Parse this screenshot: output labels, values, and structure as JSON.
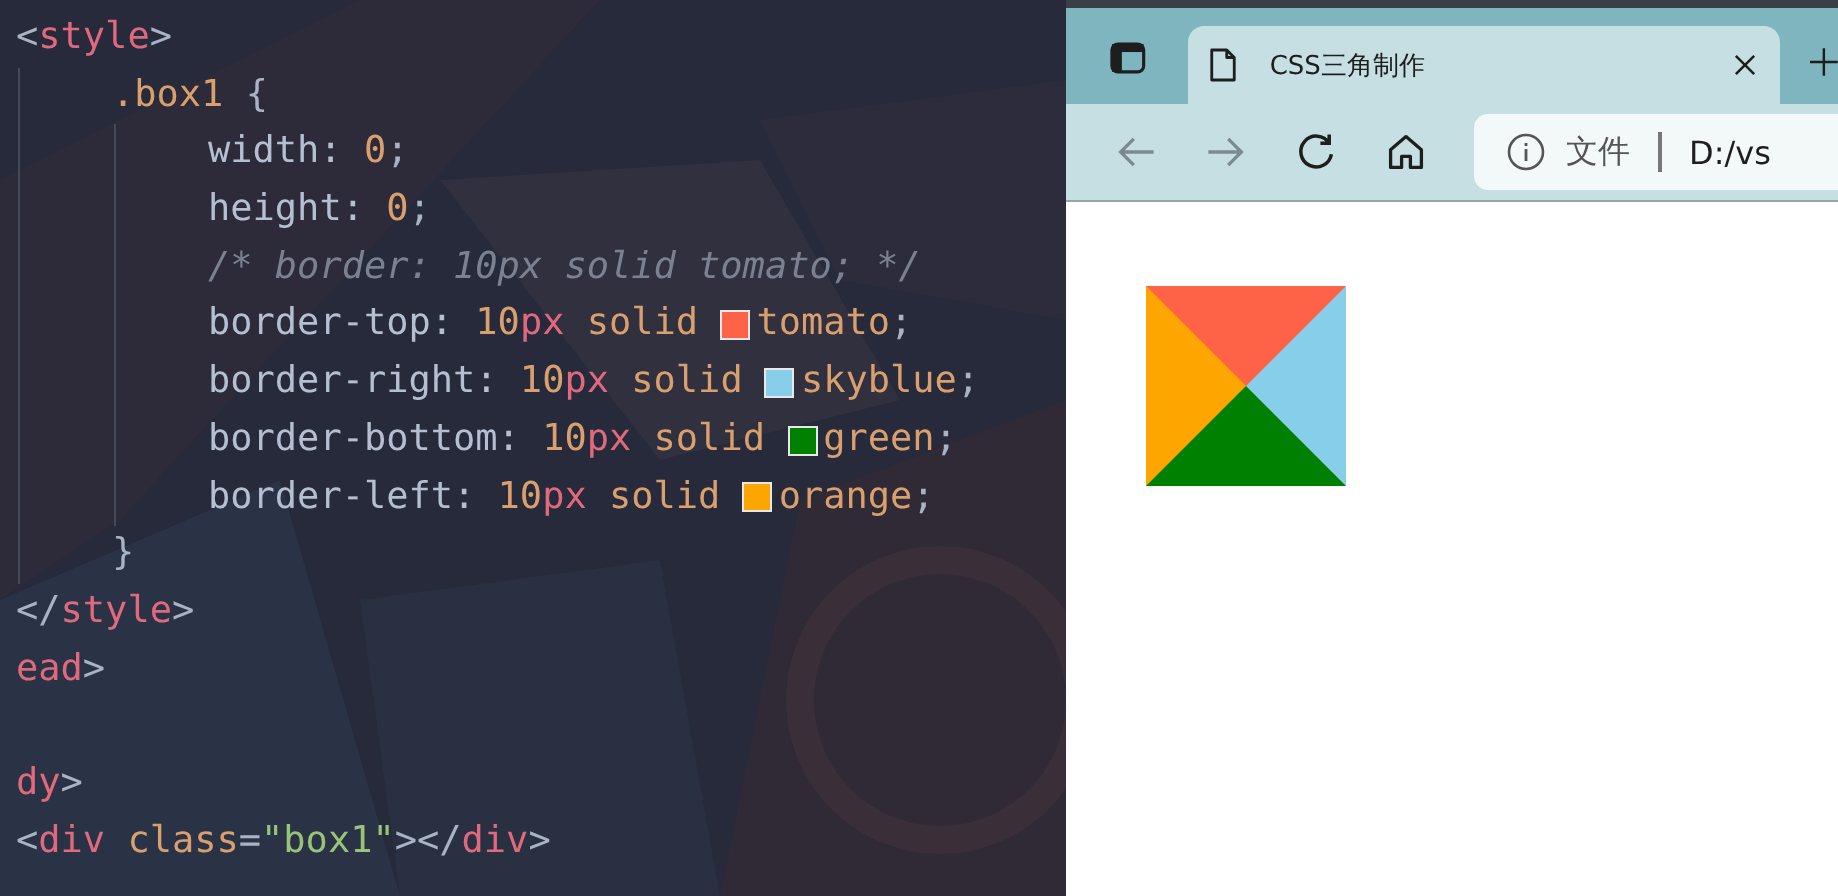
{
  "editor": {
    "groups": [
      {
        "lines": [
          {
            "tokens": [
              {
                "kind": "punct",
                "text": "<"
              },
              {
                "kind": "tag",
                "text": "style"
              },
              {
                "kind": "punct",
                "text": ">"
              }
            ],
            "children": [
              {
                "tokens": [
                  {
                    "kind": "selector",
                    "text": ".box1"
                  },
                  {
                    "kind": "punct",
                    "text": " {"
                  }
                ],
                "children": [
                  {
                    "tokens": [
                      {
                        "kind": "prop",
                        "text": "width:"
                      },
                      {
                        "kind": "num",
                        "text": " 0"
                      },
                      {
                        "kind": "punct",
                        "text": ";"
                      }
                    ]
                  },
                  {
                    "tokens": [
                      {
                        "kind": "prop",
                        "text": "height:"
                      },
                      {
                        "kind": "num",
                        "text": " 0"
                      },
                      {
                        "kind": "punct",
                        "text": ";"
                      }
                    ]
                  },
                  {
                    "tokens": [
                      {
                        "kind": "comment",
                        "text": "/* border: 10px solid tomato; */"
                      }
                    ]
                  },
                  {
                    "tokens": [
                      {
                        "kind": "prop",
                        "text": "border-top:"
                      },
                      {
                        "kind": "num",
                        "text": " 10"
                      },
                      {
                        "kind": "unit",
                        "text": "px"
                      },
                      {
                        "kind": "value",
                        "text": " solid "
                      },
                      {
                        "kind": "swatch",
                        "color": "#ff6347"
                      },
                      {
                        "kind": "value",
                        "text": "tomato"
                      },
                      {
                        "kind": "punct",
                        "text": ";"
                      }
                    ]
                  },
                  {
                    "tokens": [
                      {
                        "kind": "prop",
                        "text": "border-right:"
                      },
                      {
                        "kind": "num",
                        "text": " 10"
                      },
                      {
                        "kind": "unit",
                        "text": "px"
                      },
                      {
                        "kind": "value",
                        "text": " solid "
                      },
                      {
                        "kind": "swatch",
                        "color": "#87ceeb"
                      },
                      {
                        "kind": "value",
                        "text": "skyblue"
                      },
                      {
                        "kind": "punct",
                        "text": ";"
                      }
                    ]
                  },
                  {
                    "tokens": [
                      {
                        "kind": "prop",
                        "text": "border-bottom:"
                      },
                      {
                        "kind": "num",
                        "text": " 10"
                      },
                      {
                        "kind": "unit",
                        "text": "px"
                      },
                      {
                        "kind": "value",
                        "text": " solid "
                      },
                      {
                        "kind": "swatch",
                        "color": "#008000"
                      },
                      {
                        "kind": "value",
                        "text": "green"
                      },
                      {
                        "kind": "punct",
                        "text": ";"
                      }
                    ]
                  },
                  {
                    "tokens": [
                      {
                        "kind": "prop",
                        "text": "border-left:"
                      },
                      {
                        "kind": "num",
                        "text": " 10"
                      },
                      {
                        "kind": "unit",
                        "text": "px"
                      },
                      {
                        "kind": "value",
                        "text": " solid "
                      },
                      {
                        "kind": "swatch",
                        "color": "#ffa500"
                      },
                      {
                        "kind": "value",
                        "text": "orange"
                      },
                      {
                        "kind": "punct",
                        "text": ";"
                      }
                    ]
                  }
                ]
              },
              {
                "tokens": [
                  {
                    "kind": "punct",
                    "text": "}"
                  }
                ]
              }
            ]
          },
          {
            "tokens": [
              {
                "kind": "punct",
                "text": "</"
              },
              {
                "kind": "tag",
                "text": "style"
              },
              {
                "kind": "punct",
                "text": ">"
              }
            ]
          },
          {
            "tokens": [
              {
                "kind": "tag",
                "text": "ead"
              },
              {
                "kind": "punct",
                "text": ">"
              }
            ]
          }
        ]
      },
      {
        "lines": [
          {
            "tokens": [
              {
                "kind": "tag",
                "text": "dy"
              },
              {
                "kind": "punct",
                "text": ">"
              }
            ]
          },
          {
            "tokens": [
              {
                "kind": "punct",
                "text": "<"
              },
              {
                "kind": "tag",
                "text": "div"
              },
              {
                "kind": "attr",
                "text": " class"
              },
              {
                "kind": "punct",
                "text": "="
              },
              {
                "kind": "string",
                "text": "\"box1\""
              },
              {
                "kind": "punct",
                "text": "></"
              },
              {
                "kind": "tag",
                "text": "div"
              },
              {
                "kind": "punct",
                "text": ">"
              }
            ]
          }
        ]
      }
    ]
  },
  "browser": {
    "tab": {
      "title": "CSS三角制作"
    },
    "address": {
      "scheme": "文件",
      "url": "D:/vs"
    }
  }
}
